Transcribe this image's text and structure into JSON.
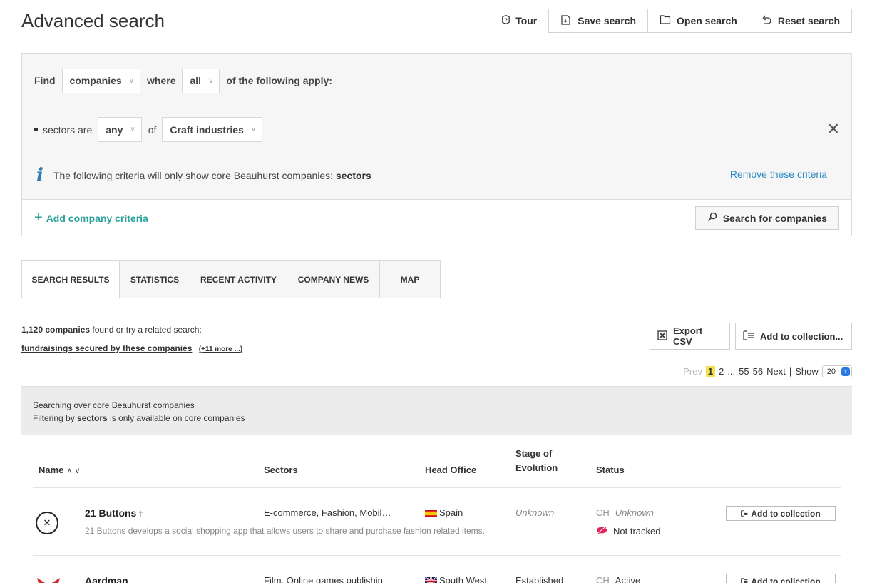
{
  "header": {
    "title": "Advanced search",
    "tour_label": "Tour",
    "save_label": "Save search",
    "open_label": "Open search",
    "reset_label": "Reset search"
  },
  "criteria": {
    "find_label": "Find",
    "entity_value": "companies",
    "where_label": "where",
    "match_value": "all",
    "apply_label": "of the following apply:",
    "rule": {
      "field_label": "sectors are",
      "quantifier_value": "any",
      "of_label": "of",
      "sector_value": "Craft industries"
    },
    "info": {
      "text_prefix": "The following criteria will only show core Beauhurst companies: ",
      "text_bold": "sectors",
      "remove_label": "Remove these criteria"
    },
    "add_label": "Add company criteria",
    "search_label": "Search for companies"
  },
  "tabs": [
    {
      "label": "SEARCH RESULTS",
      "active": true
    },
    {
      "label": "STATISTICS",
      "active": false
    },
    {
      "label": "RECENT ACTIVITY",
      "active": false
    },
    {
      "label": "COMPANY NEWS",
      "active": false
    },
    {
      "label": "MAP",
      "active": false
    }
  ],
  "results": {
    "count": "1,120 companies",
    "count_suffix": " found or try a related search:",
    "related_link": "fundraisings secured by these companies",
    "more_link": "(+11 more ...)",
    "export_label": "Export CSV",
    "collection_label": "Add to collection...",
    "pager": {
      "prev": "Prev",
      "current": "1",
      "next_page": "2",
      "ellipsis": "...",
      "p55": "55",
      "p56": "56",
      "next": "Next",
      "separator": "|",
      "show_label": "Show",
      "show_value": "20"
    }
  },
  "notice": {
    "line1": "Searching over core Beauhurst companies",
    "line2_prefix": "Filtering by ",
    "line2_bold": "sectors",
    "line2_suffix": " is only available on core companies"
  },
  "table": {
    "headers": {
      "name": "Name",
      "sectors": "Sectors",
      "head_office": "Head Office",
      "stage_line1": "Stage of",
      "stage_line2": "Evolution",
      "status": "Status"
    },
    "rows": [
      {
        "name": "21 Buttons",
        "marker": "†",
        "description": "21 Buttons develops a social shopping app that allows users to share and purchase fashion related items.",
        "sectors": "E-commerce, Fashion, Mobil…",
        "head_office": "Spain",
        "stage": "Unknown",
        "status_code": "CH",
        "status": "Unknown",
        "tracking": "Not tracked",
        "button": "Add to collection",
        "logo_icon": "x-circle-icon"
      },
      {
        "name": "Aardman",
        "description": "",
        "sectors": "Film, Online games publishin",
        "head_office": "South West",
        "stage": "Established",
        "status_code": "CH",
        "status": "Active",
        "button": "Add to collection",
        "logo_icon": "aardman-logo"
      }
    ]
  },
  "colors": {
    "accent_teal": "#2aa39b",
    "link_blue": "#2a8bc4",
    "page_highlight": "#f2e14a",
    "tracked_red": "#e0245e"
  }
}
